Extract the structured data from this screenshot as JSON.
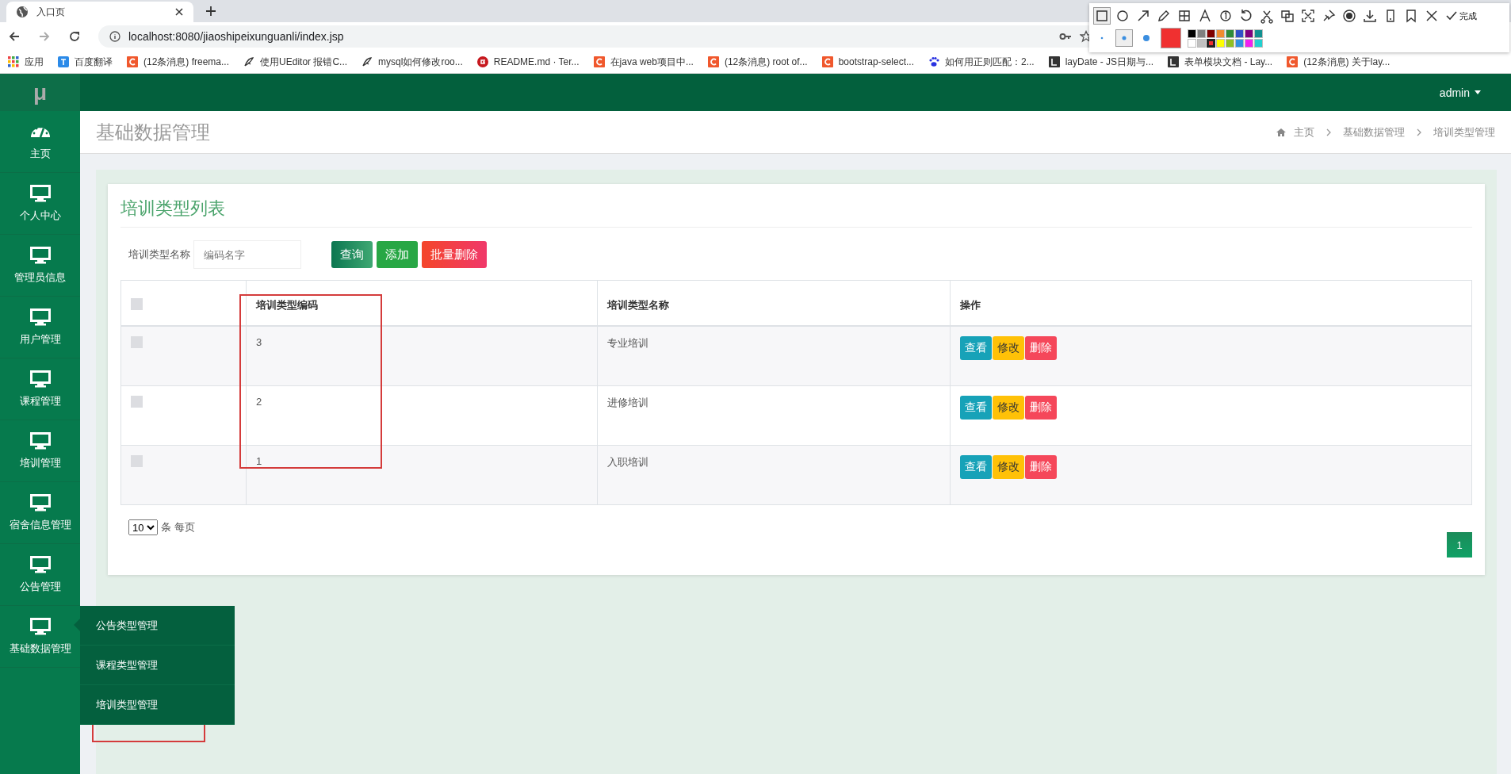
{
  "browser": {
    "tab_title": "入口页",
    "url": "localhost:8080/jiaoshipeixunguanli/index.jsp",
    "bookmarks": [
      {
        "label": "应用",
        "kind": "apps"
      },
      {
        "label": "百度翻译",
        "kind": "blue"
      },
      {
        "label": "(12条消息) freema...",
        "kind": "orange"
      },
      {
        "label": "使用UEditor 报错C...",
        "kind": "feather"
      },
      {
        "label": "mysql如何修改roo...",
        "kind": "feather"
      },
      {
        "label": "README.md · Ter...",
        "kind": "red-circle"
      },
      {
        "label": "在java web项目中...",
        "kind": "orange"
      },
      {
        "label": "(12条消息) root of...",
        "kind": "orange"
      },
      {
        "label": "bootstrap-select...",
        "kind": "orange"
      },
      {
        "label": "如何用正则匹配：2...",
        "kind": "paw"
      },
      {
        "label": "layDate - JS日期与...",
        "kind": "dark"
      },
      {
        "label": "表单模块文档 - Lay...",
        "kind": "dark"
      },
      {
        "label": "(12条消息) 关于lay...",
        "kind": "orange"
      }
    ]
  },
  "capture_toolbar": {
    "tools": [
      {
        "kind": "rect",
        "selected": true
      },
      {
        "kind": "circle",
        "selected": false
      },
      {
        "kind": "arrow",
        "selected": false
      },
      {
        "kind": "pen",
        "selected": false
      },
      {
        "kind": "mosaic",
        "selected": false
      },
      {
        "kind": "text",
        "selected": false
      },
      {
        "kind": "number",
        "selected": false
      },
      {
        "kind": "undo",
        "selected": false
      },
      {
        "kind": "cut",
        "selected": false
      },
      {
        "kind": "ocr",
        "selected": false
      },
      {
        "kind": "scan",
        "selected": false
      },
      {
        "kind": "pin",
        "selected": false
      },
      {
        "kind": "record",
        "selected": false
      },
      {
        "kind": "download",
        "selected": false
      },
      {
        "kind": "phone",
        "selected": false
      },
      {
        "kind": "bookmark",
        "selected": false
      },
      {
        "kind": "close",
        "selected": false
      }
    ],
    "done_label": "完成",
    "colors": [
      {
        "color": "#000000",
        "selected": false
      },
      {
        "color": "#808080",
        "selected": false
      },
      {
        "color": "#800000",
        "selected": false
      },
      {
        "color": "#f08c30",
        "selected": false
      },
      {
        "color": "#2e8b3a",
        "selected": false
      },
      {
        "color": "#3050c8",
        "selected": false
      },
      {
        "color": "#800080",
        "selected": false
      },
      {
        "color": "#109090",
        "selected": false
      },
      {
        "color": "#ffffff",
        "selected": false
      },
      {
        "color": "#c0c0c0",
        "selected": false
      },
      {
        "color": "#f03030",
        "selected": true
      },
      {
        "color": "#ffff00",
        "selected": false
      },
      {
        "color": "#90c020",
        "selected": false
      },
      {
        "color": "#3090e0",
        "selected": false
      },
      {
        "color": "#f020f0",
        "selected": false
      },
      {
        "color": "#20d0d0",
        "selected": false
      }
    ]
  },
  "app": {
    "logo": "μ",
    "user": "admin",
    "sidebar": [
      {
        "label": "主页",
        "kind": "gauge"
      },
      {
        "label": "个人中心",
        "kind": "monitor"
      },
      {
        "label": "管理员信息",
        "kind": "monitor"
      },
      {
        "label": "用户管理",
        "kind": "monitor"
      },
      {
        "label": "课程管理",
        "kind": "monitor"
      },
      {
        "label": "培训管理",
        "kind": "monitor"
      },
      {
        "label": "宿舍信息管理",
        "kind": "monitor"
      },
      {
        "label": "公告管理",
        "kind": "monitor"
      },
      {
        "label": "基础数据管理",
        "kind": "monitor",
        "expanded": true,
        "children": [
          {
            "label": "公告类型管理"
          },
          {
            "label": "课程类型管理"
          },
          {
            "label": "培训类型管理"
          }
        ]
      }
    ],
    "page_title": "基础数据管理",
    "breadcrumbs": [
      "主页",
      "基础数据管理",
      "培训类型管理"
    ],
    "card": {
      "title": "培训类型列表",
      "search_label": "培训类型名称",
      "placeholder": "编码名字",
      "buttons": [
        {
          "label": "查询",
          "kind": "search"
        },
        {
          "label": "添加",
          "kind": "add"
        },
        {
          "label": "批量删除",
          "kind": "delete"
        }
      ],
      "table": {
        "select_all_checked": false,
        "columns": [
          "培训类型编码",
          "培训类型名称",
          "操作"
        ],
        "rows": [
          {
            "checked": false,
            "code": "3",
            "name": "专业培训",
            "actions": [
              {
                "label": "查看",
                "kind": "view"
              },
              {
                "label": "修改",
                "kind": "edit"
              },
              {
                "label": "删除",
                "kind": "delete"
              }
            ]
          },
          {
            "checked": false,
            "code": "2",
            "name": "进修培训",
            "actions": [
              {
                "label": "查看",
                "kind": "view"
              },
              {
                "label": "修改",
                "kind": "edit"
              },
              {
                "label": "删除",
                "kind": "delete"
              }
            ]
          },
          {
            "checked": false,
            "code": "1",
            "name": "入职培训",
            "actions": [
              {
                "label": "查看",
                "kind": "view"
              },
              {
                "label": "修改",
                "kind": "edit"
              },
              {
                "label": "删除",
                "kind": "delete"
              }
            ]
          }
        ]
      },
      "page_size": "10",
      "page_size_suffix": "条 每页",
      "pages": [
        {
          "label": "1",
          "selected": true
        }
      ]
    }
  }
}
